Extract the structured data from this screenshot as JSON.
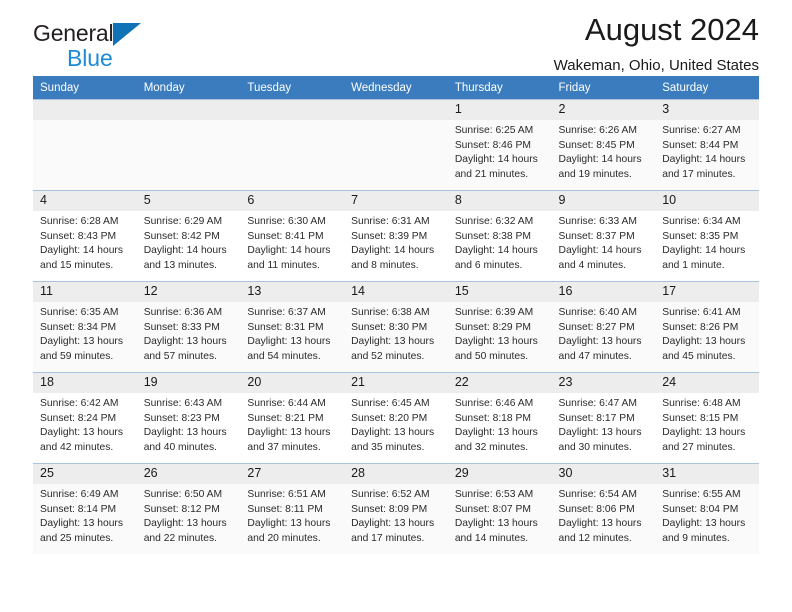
{
  "brand": {
    "name_part1": "General",
    "name_part2": "Blue",
    "logo_icon": "triangle-logo-icon"
  },
  "header": {
    "title": "August 2024",
    "subtitle": "Wakeman, Ohio, United States"
  },
  "calendar": {
    "weekday_headers": [
      "Sunday",
      "Monday",
      "Tuesday",
      "Wednesday",
      "Thursday",
      "Friday",
      "Saturday"
    ],
    "accent_color": "#3a7cbe",
    "daynum_bg": "#ededed",
    "row_shade": "#fafafa",
    "weeks": [
      [
        {
          "day": "",
          "empty": true
        },
        {
          "day": "",
          "empty": true
        },
        {
          "day": "",
          "empty": true
        },
        {
          "day": "",
          "empty": true
        },
        {
          "day": "1",
          "sunrise": "Sunrise: 6:25 AM",
          "sunset": "Sunset: 8:46 PM",
          "daylight1": "Daylight: 14 hours",
          "daylight2": "and 21 minutes."
        },
        {
          "day": "2",
          "sunrise": "Sunrise: 6:26 AM",
          "sunset": "Sunset: 8:45 PM",
          "daylight1": "Daylight: 14 hours",
          "daylight2": "and 19 minutes."
        },
        {
          "day": "3",
          "sunrise": "Sunrise: 6:27 AM",
          "sunset": "Sunset: 8:44 PM",
          "daylight1": "Daylight: 14 hours",
          "daylight2": "and 17 minutes."
        }
      ],
      [
        {
          "day": "4",
          "sunrise": "Sunrise: 6:28 AM",
          "sunset": "Sunset: 8:43 PM",
          "daylight1": "Daylight: 14 hours",
          "daylight2": "and 15 minutes."
        },
        {
          "day": "5",
          "sunrise": "Sunrise: 6:29 AM",
          "sunset": "Sunset: 8:42 PM",
          "daylight1": "Daylight: 14 hours",
          "daylight2": "and 13 minutes."
        },
        {
          "day": "6",
          "sunrise": "Sunrise: 6:30 AM",
          "sunset": "Sunset: 8:41 PM",
          "daylight1": "Daylight: 14 hours",
          "daylight2": "and 11 minutes."
        },
        {
          "day": "7",
          "sunrise": "Sunrise: 6:31 AM",
          "sunset": "Sunset: 8:39 PM",
          "daylight1": "Daylight: 14 hours",
          "daylight2": "and 8 minutes."
        },
        {
          "day": "8",
          "sunrise": "Sunrise: 6:32 AM",
          "sunset": "Sunset: 8:38 PM",
          "daylight1": "Daylight: 14 hours",
          "daylight2": "and 6 minutes."
        },
        {
          "day": "9",
          "sunrise": "Sunrise: 6:33 AM",
          "sunset": "Sunset: 8:37 PM",
          "daylight1": "Daylight: 14 hours",
          "daylight2": "and 4 minutes."
        },
        {
          "day": "10",
          "sunrise": "Sunrise: 6:34 AM",
          "sunset": "Sunset: 8:35 PM",
          "daylight1": "Daylight: 14 hours",
          "daylight2": "and 1 minute."
        }
      ],
      [
        {
          "day": "11",
          "sunrise": "Sunrise: 6:35 AM",
          "sunset": "Sunset: 8:34 PM",
          "daylight1": "Daylight: 13 hours",
          "daylight2": "and 59 minutes."
        },
        {
          "day": "12",
          "sunrise": "Sunrise: 6:36 AM",
          "sunset": "Sunset: 8:33 PM",
          "daylight1": "Daylight: 13 hours",
          "daylight2": "and 57 minutes."
        },
        {
          "day": "13",
          "sunrise": "Sunrise: 6:37 AM",
          "sunset": "Sunset: 8:31 PM",
          "daylight1": "Daylight: 13 hours",
          "daylight2": "and 54 minutes."
        },
        {
          "day": "14",
          "sunrise": "Sunrise: 6:38 AM",
          "sunset": "Sunset: 8:30 PM",
          "daylight1": "Daylight: 13 hours",
          "daylight2": "and 52 minutes."
        },
        {
          "day": "15",
          "sunrise": "Sunrise: 6:39 AM",
          "sunset": "Sunset: 8:29 PM",
          "daylight1": "Daylight: 13 hours",
          "daylight2": "and 50 minutes."
        },
        {
          "day": "16",
          "sunrise": "Sunrise: 6:40 AM",
          "sunset": "Sunset: 8:27 PM",
          "daylight1": "Daylight: 13 hours",
          "daylight2": "and 47 minutes."
        },
        {
          "day": "17",
          "sunrise": "Sunrise: 6:41 AM",
          "sunset": "Sunset: 8:26 PM",
          "daylight1": "Daylight: 13 hours",
          "daylight2": "and 45 minutes."
        }
      ],
      [
        {
          "day": "18",
          "sunrise": "Sunrise: 6:42 AM",
          "sunset": "Sunset: 8:24 PM",
          "daylight1": "Daylight: 13 hours",
          "daylight2": "and 42 minutes."
        },
        {
          "day": "19",
          "sunrise": "Sunrise: 6:43 AM",
          "sunset": "Sunset: 8:23 PM",
          "daylight1": "Daylight: 13 hours",
          "daylight2": "and 40 minutes."
        },
        {
          "day": "20",
          "sunrise": "Sunrise: 6:44 AM",
          "sunset": "Sunset: 8:21 PM",
          "daylight1": "Daylight: 13 hours",
          "daylight2": "and 37 minutes."
        },
        {
          "day": "21",
          "sunrise": "Sunrise: 6:45 AM",
          "sunset": "Sunset: 8:20 PM",
          "daylight1": "Daylight: 13 hours",
          "daylight2": "and 35 minutes."
        },
        {
          "day": "22",
          "sunrise": "Sunrise: 6:46 AM",
          "sunset": "Sunset: 8:18 PM",
          "daylight1": "Daylight: 13 hours",
          "daylight2": "and 32 minutes."
        },
        {
          "day": "23",
          "sunrise": "Sunrise: 6:47 AM",
          "sunset": "Sunset: 8:17 PM",
          "daylight1": "Daylight: 13 hours",
          "daylight2": "and 30 minutes."
        },
        {
          "day": "24",
          "sunrise": "Sunrise: 6:48 AM",
          "sunset": "Sunset: 8:15 PM",
          "daylight1": "Daylight: 13 hours",
          "daylight2": "and 27 minutes."
        }
      ],
      [
        {
          "day": "25",
          "sunrise": "Sunrise: 6:49 AM",
          "sunset": "Sunset: 8:14 PM",
          "daylight1": "Daylight: 13 hours",
          "daylight2": "and 25 minutes."
        },
        {
          "day": "26",
          "sunrise": "Sunrise: 6:50 AM",
          "sunset": "Sunset: 8:12 PM",
          "daylight1": "Daylight: 13 hours",
          "daylight2": "and 22 minutes."
        },
        {
          "day": "27",
          "sunrise": "Sunrise: 6:51 AM",
          "sunset": "Sunset: 8:11 PM",
          "daylight1": "Daylight: 13 hours",
          "daylight2": "and 20 minutes."
        },
        {
          "day": "28",
          "sunrise": "Sunrise: 6:52 AM",
          "sunset": "Sunset: 8:09 PM",
          "daylight1": "Daylight: 13 hours",
          "daylight2": "and 17 minutes."
        },
        {
          "day": "29",
          "sunrise": "Sunrise: 6:53 AM",
          "sunset": "Sunset: 8:07 PM",
          "daylight1": "Daylight: 13 hours",
          "daylight2": "and 14 minutes."
        },
        {
          "day": "30",
          "sunrise": "Sunrise: 6:54 AM",
          "sunset": "Sunset: 8:06 PM",
          "daylight1": "Daylight: 13 hours",
          "daylight2": "and 12 minutes."
        },
        {
          "day": "31",
          "sunrise": "Sunrise: 6:55 AM",
          "sunset": "Sunset: 8:04 PM",
          "daylight1": "Daylight: 13 hours",
          "daylight2": "and 9 minutes."
        }
      ]
    ]
  }
}
